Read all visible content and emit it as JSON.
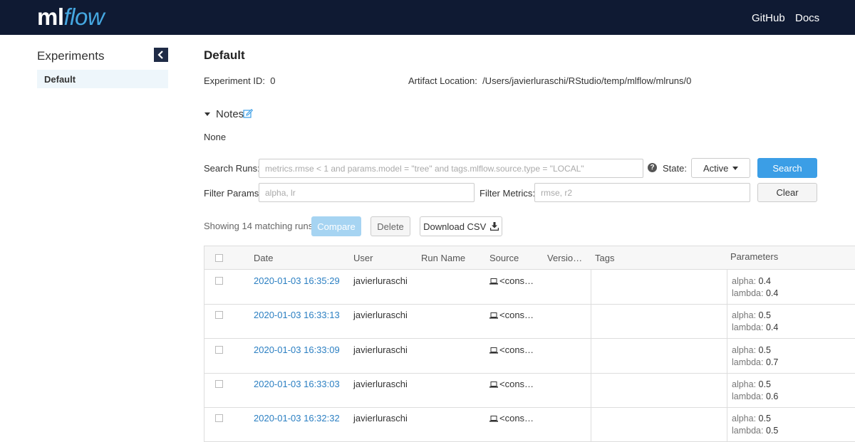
{
  "header": {
    "logo_ml": "ml",
    "logo_flow": "flow",
    "nav": [
      "GitHub",
      "Docs"
    ],
    "colors": {
      "background": "#0f1a33",
      "accent": "#45a7e0"
    }
  },
  "sidebar": {
    "title": "Experiments",
    "collapse_icon": "chevron-left-icon",
    "items": [
      {
        "label": "Default",
        "selected": true
      }
    ]
  },
  "experiment": {
    "name": "Default",
    "id_label": "Experiment ID",
    "id_value": "0",
    "artifact_label": "Artifact Location",
    "artifact_value": "/Users/javierluraschi/RStudio/temp/mlflow/mlruns/0"
  },
  "notes": {
    "label": "Notes",
    "content": "None",
    "toggle_icon": "caret-down-icon",
    "edit_icon": "edit-icon"
  },
  "search": {
    "runs_label": "Search Runs:",
    "runs_placeholder": "metrics.rmse < 1 and params.model = \"tree\" and tags.mlflow.source.type = \"LOCAL\"",
    "help_icon": "?",
    "state_label": "State:",
    "state_value": "Active",
    "search_button": "Search",
    "params_label": "Filter Params:",
    "params_placeholder": "alpha, lr",
    "metrics_label": "Filter Metrics:",
    "metrics_placeholder": "rmse, r2",
    "clear_button": "Clear"
  },
  "toolbar": {
    "status": "Showing 14 matching runs",
    "compare": "Compare",
    "delete": "Delete",
    "download": "Download CSV"
  },
  "table": {
    "headers": {
      "date": "Date",
      "user": "User",
      "run_name": "Run Name",
      "source": "Source",
      "version": "Versio…",
      "tags": "Tags",
      "parameters": "Parameters"
    },
    "rows": [
      {
        "date": "2020-01-03 16:35:29",
        "user": "javierluraschi",
        "source": "<cons…",
        "params": [
          {
            "k": "alpha",
            "v": "0.4"
          },
          {
            "k": "lambda",
            "v": "0.4"
          }
        ]
      },
      {
        "date": "2020-01-03 16:33:13",
        "user": "javierluraschi",
        "source": "<cons…",
        "params": [
          {
            "k": "alpha",
            "v": "0.5"
          },
          {
            "k": "lambda",
            "v": "0.4"
          }
        ]
      },
      {
        "date": "2020-01-03 16:33:09",
        "user": "javierluraschi",
        "source": "<cons…",
        "params": [
          {
            "k": "alpha",
            "v": "0.5"
          },
          {
            "k": "lambda",
            "v": "0.7"
          }
        ]
      },
      {
        "date": "2020-01-03 16:33:03",
        "user": "javierluraschi",
        "source": "<cons…",
        "params": [
          {
            "k": "alpha",
            "v": "0.5"
          },
          {
            "k": "lambda",
            "v": "0.6"
          }
        ]
      },
      {
        "date": "2020-01-03 16:32:32",
        "user": "javierluraschi",
        "source": "<cons…",
        "params": [
          {
            "k": "alpha",
            "v": "0.5"
          },
          {
            "k": "lambda",
            "v": "0.5"
          }
        ]
      }
    ]
  }
}
